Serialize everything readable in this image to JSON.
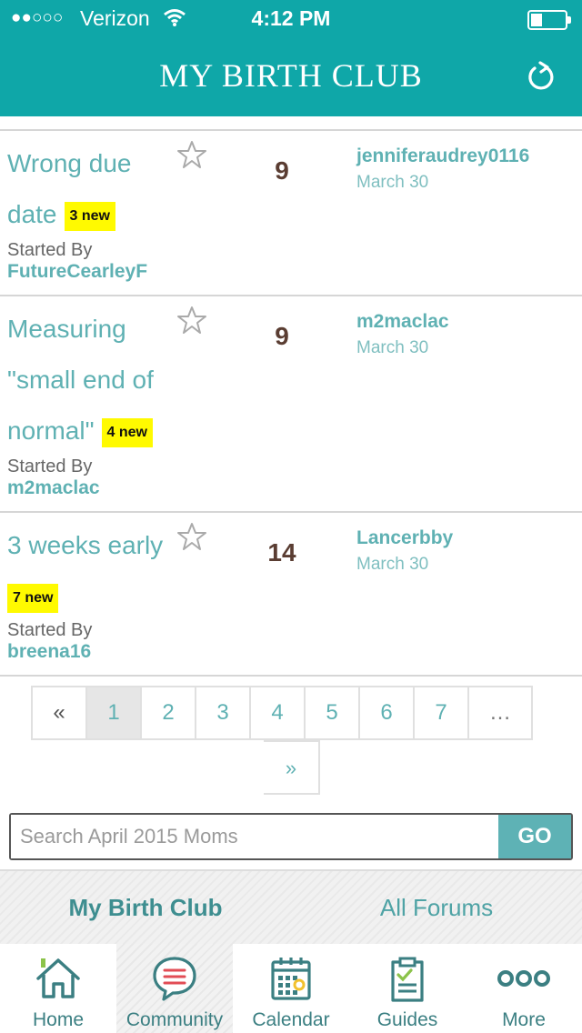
{
  "status_bar": {
    "signal": "●●○○○",
    "carrier": "Verizon",
    "time": "4:12 PM"
  },
  "header": {
    "title": "MY BIRTH CLUB"
  },
  "topics": [
    {
      "title_line1": "Wrong due",
      "title_line2": "date",
      "badge": "3 new",
      "replies": "9",
      "last_user": "jenniferaudrey0116",
      "last_date": "March 30",
      "started_label": "Started By",
      "author": "FutureCearleyF"
    },
    {
      "title_line1": "Measuring",
      "title_line2": "\"small end of",
      "title_line3": "normal\"",
      "badge": "4 new",
      "replies": "9",
      "last_user": "m2maclac",
      "last_date": "March 30",
      "started_label": "Started By",
      "author": "m2maclac"
    },
    {
      "title_line1": "3 weeks early",
      "badge": "7 new",
      "replies": "14",
      "last_user": "Lancerbby",
      "last_date": "March 30",
      "started_label": "Started By",
      "author": "breena16"
    }
  ],
  "pagination": {
    "prev": "«",
    "pages": [
      "1",
      "2",
      "3",
      "4",
      "5",
      "6",
      "7"
    ],
    "ellipsis": "…",
    "next": "»",
    "current": "1"
  },
  "search": {
    "placeholder": "Search April 2015 Moms",
    "button": "GO"
  },
  "subtabs": {
    "left": "My Birth Club",
    "right": "All Forums"
  },
  "bottom_nav": [
    {
      "label": "Home",
      "icon": "home-icon"
    },
    {
      "label": "Community",
      "icon": "chat-bubble-icon",
      "active": true
    },
    {
      "label": "Calendar",
      "icon": "calendar-icon"
    },
    {
      "label": "Guides",
      "icon": "clipboard-icon"
    },
    {
      "label": "More",
      "icon": "more-dots-icon"
    }
  ],
  "colors": {
    "header_teal": "#0fa7a8",
    "link_teal": "#5fb1b3",
    "badge_yellow": "#fffa00",
    "count_brown": "#5a3d32"
  }
}
